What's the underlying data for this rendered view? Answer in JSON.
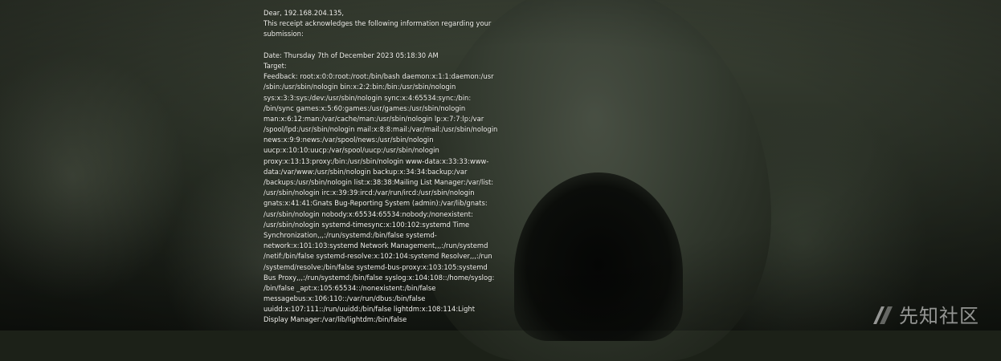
{
  "receipt": {
    "lines": [
      "Dear, 192.168.204.135,",
      "This receipt acknowledges the following information regarding your",
      "submission:",
      "",
      "Date: Thursday 7th of December 2023 05:18:30 AM",
      "Target:",
      "Feedback: root:x:0:0:root:/root:/bin/bash daemon:x:1:1:daemon:/usr",
      "/sbin:/usr/sbin/nologin bin:x:2:2:bin:/bin:/usr/sbin/nologin",
      "sys:x:3:3:sys:/dev:/usr/sbin/nologin sync:x:4:65534:sync:/bin:",
      "/bin/sync games:x:5:60:games:/usr/games:/usr/sbin/nologin",
      "man:x:6:12:man:/var/cache/man:/usr/sbin/nologin lp:x:7:7:lp:/var",
      "/spool/lpd:/usr/sbin/nologin mail:x:8:8:mail:/var/mail:/usr/sbin/nologin",
      "news:x:9:9:news:/var/spool/news:/usr/sbin/nologin",
      "uucp:x:10:10:uucp:/var/spool/uucp:/usr/sbin/nologin",
      "proxy:x:13:13:proxy:/bin:/usr/sbin/nologin www-data:x:33:33:www-",
      "data:/var/www:/usr/sbin/nologin backup:x:34:34:backup:/var",
      "/backups:/usr/sbin/nologin list:x:38:38:Mailing List Manager:/var/list:",
      "/usr/sbin/nologin irc:x:39:39:ircd:/var/run/ircd:/usr/sbin/nologin",
      "gnats:x:41:41:Gnats Bug-Reporting System (admin):/var/lib/gnats:",
      "/usr/sbin/nologin nobody:x:65534:65534:nobody:/nonexistent:",
      "/usr/sbin/nologin systemd-timesync:x:100:102:systemd Time",
      "Synchronization,,,:/run/systemd:/bin/false systemd-",
      "network:x:101:103:systemd Network Management,,,:/run/systemd",
      "/netif:/bin/false systemd-resolve:x:102:104:systemd Resolver,,,:/run",
      "/systemd/resolve:/bin/false systemd-bus-proxy:x:103:105:systemd",
      "Bus Proxy,,,:/run/systemd:/bin/false syslog:x:104:108::/home/syslog:",
      "/bin/false _apt:x:105:65534::/nonexistent:/bin/false",
      "messagebus:x:106:110::/var/run/dbus:/bin/false",
      "uuidd:x:107:111::/run/uuidd:/bin/false lightdm:x:108:114:Light",
      "Display Manager:/var/lib/lightdm:/bin/false"
    ]
  },
  "watermark": {
    "text": "先知社区",
    "icon": "xianzhi-logo-icon"
  }
}
